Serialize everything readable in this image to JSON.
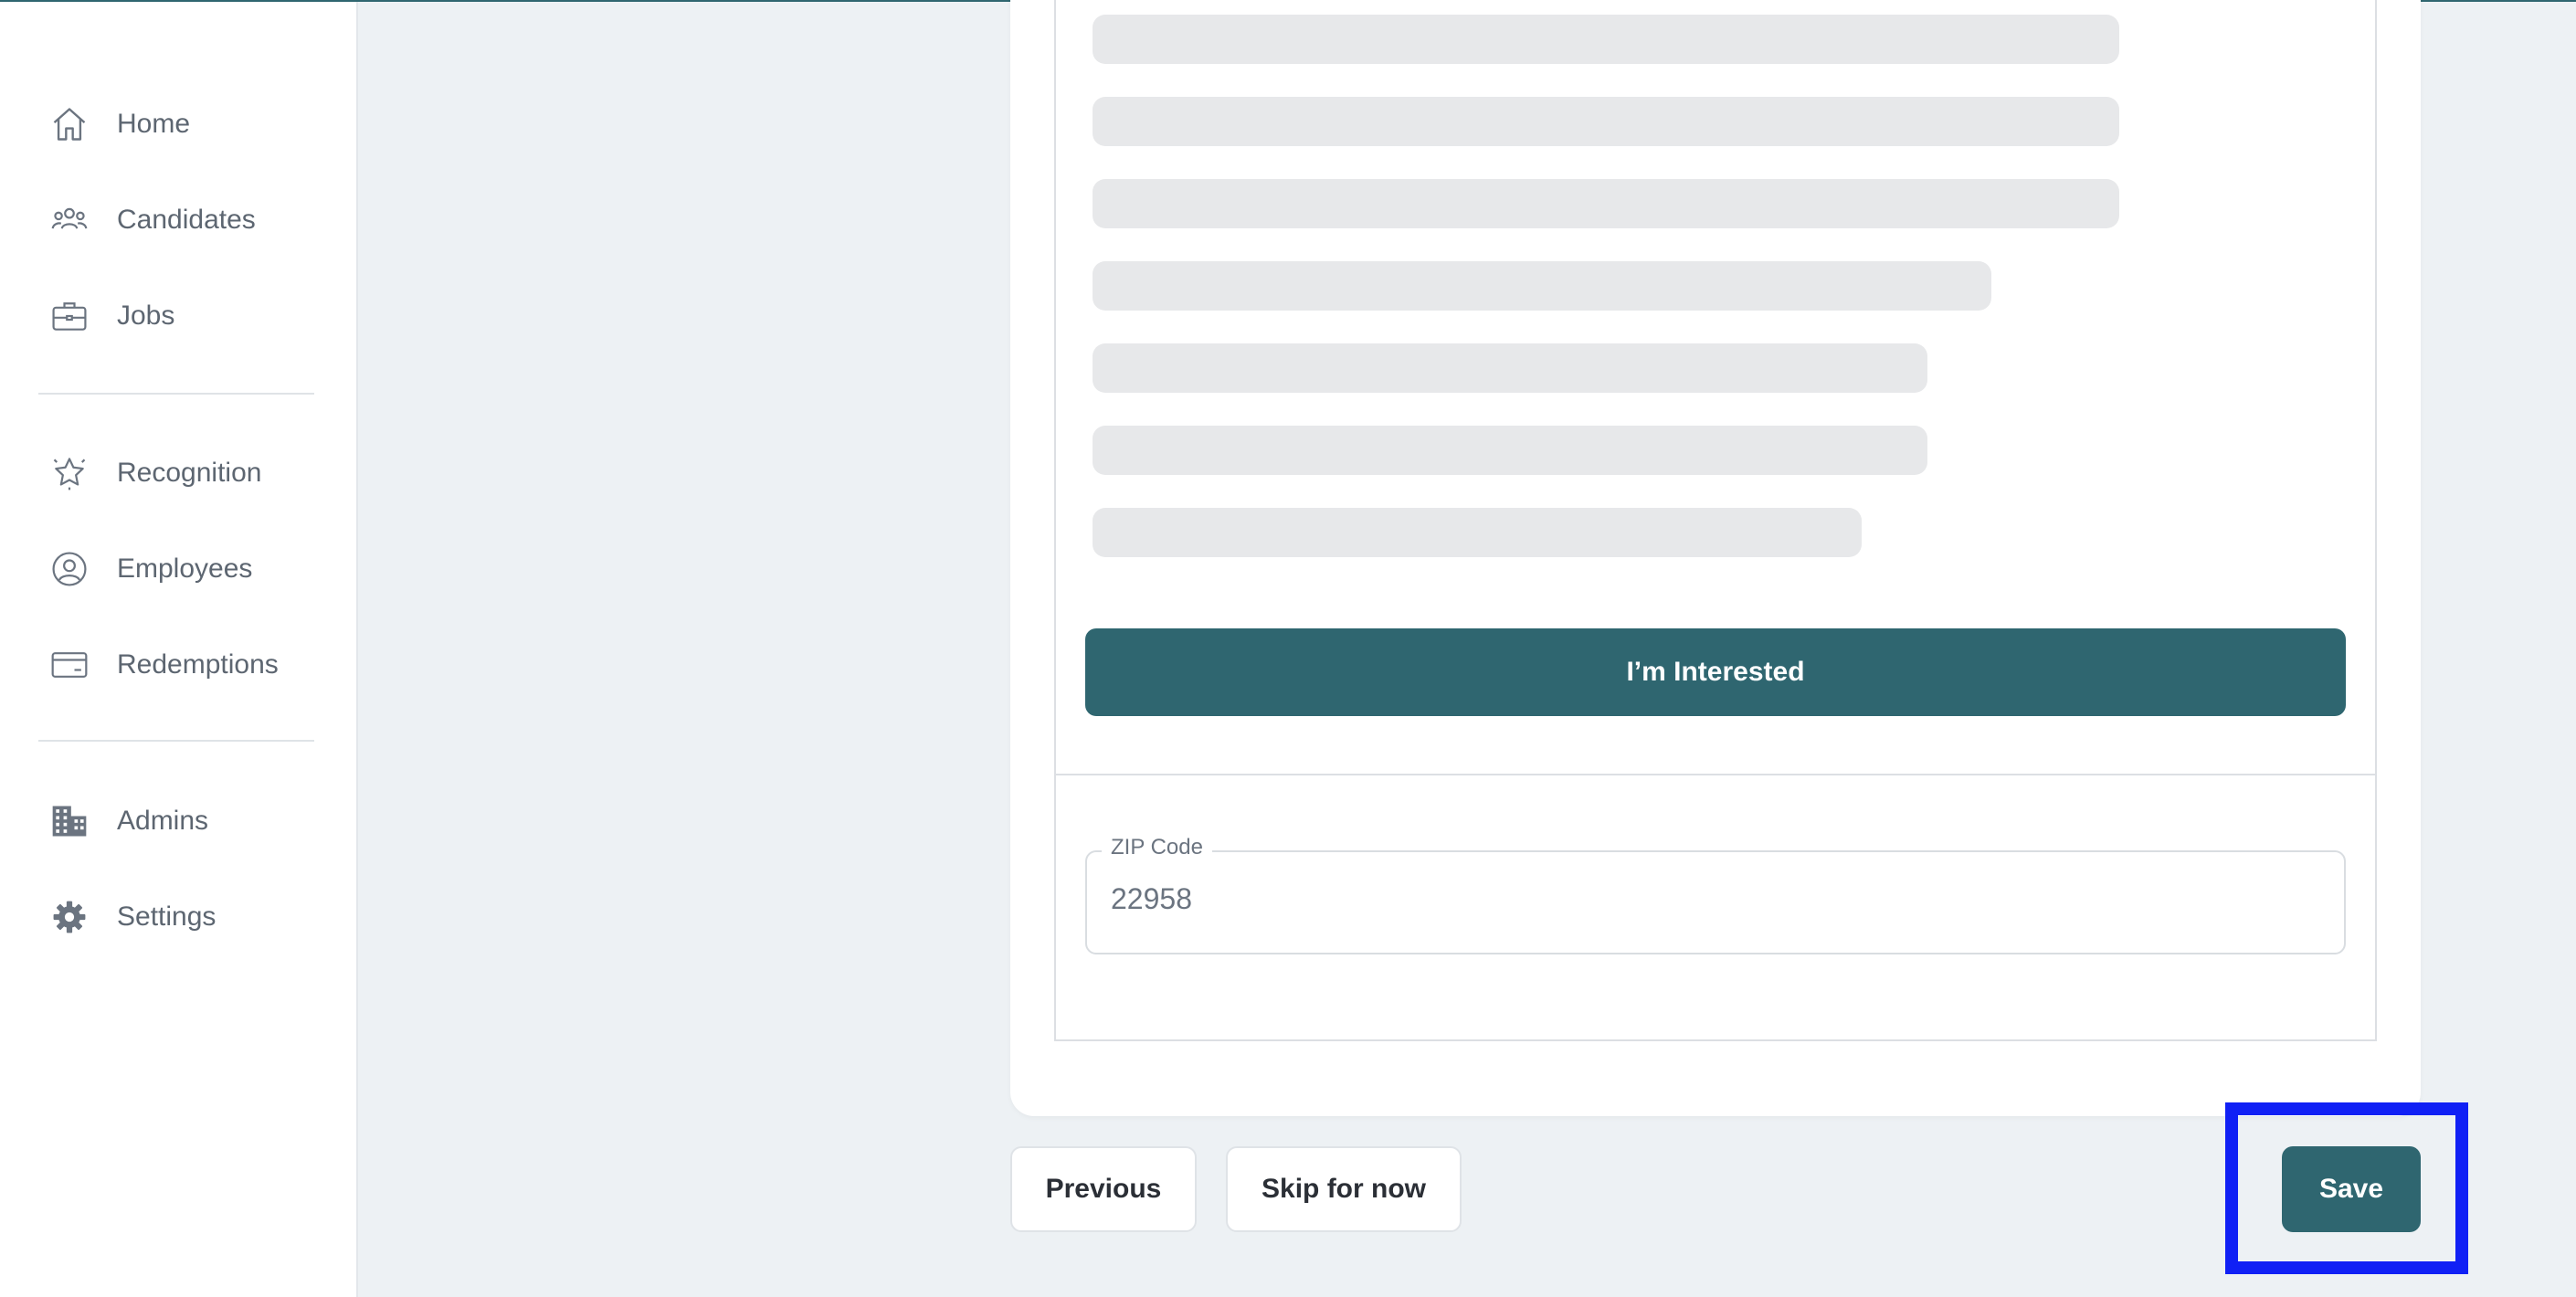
{
  "sidebar": {
    "items": [
      {
        "label": "Home",
        "icon": "home-icon"
      },
      {
        "label": "Candidates",
        "icon": "people-icon"
      },
      {
        "label": "Jobs",
        "icon": "briefcase-icon"
      },
      {
        "label": "Recognition",
        "icon": "star-badge-icon"
      },
      {
        "label": "Employees",
        "icon": "user-circle-icon"
      },
      {
        "label": "Redemptions",
        "icon": "credit-card-icon"
      },
      {
        "label": "Admins",
        "icon": "building-icon"
      },
      {
        "label": "Settings",
        "icon": "gear-icon"
      }
    ]
  },
  "main": {
    "interested_label": "I’m Interested",
    "zip": {
      "label": "ZIP Code",
      "value": "22958"
    }
  },
  "footer": {
    "previous_label": "Previous",
    "skip_label": "Skip for now",
    "save_label": "Save"
  },
  "colors": {
    "primary": "#2f6670",
    "highlight": "#1020f5",
    "skeleton": "#e7e8ea",
    "background": "#edf1f4"
  }
}
